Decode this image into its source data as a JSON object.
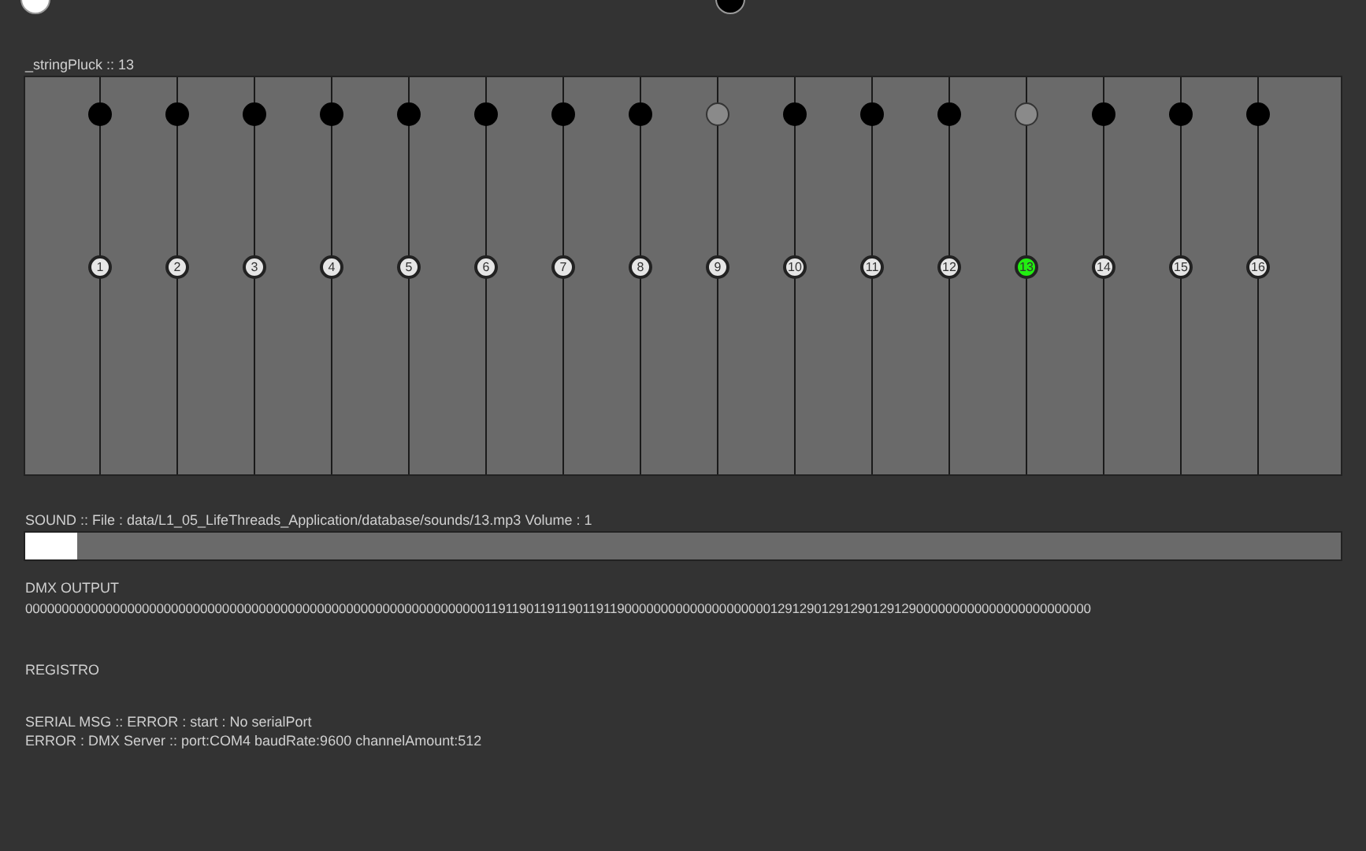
{
  "indicators": [
    {
      "on": true
    },
    {
      "on": false
    }
  ],
  "pluck": {
    "label": "_stringPluck :: 13"
  },
  "strings": [
    {
      "label": "1",
      "active": true,
      "selected": false
    },
    {
      "label": "2",
      "active": true,
      "selected": false
    },
    {
      "label": "3",
      "active": true,
      "selected": false
    },
    {
      "label": "4",
      "active": true,
      "selected": false
    },
    {
      "label": "5",
      "active": true,
      "selected": false
    },
    {
      "label": "6",
      "active": true,
      "selected": false
    },
    {
      "label": "7",
      "active": true,
      "selected": false
    },
    {
      "label": "8",
      "active": true,
      "selected": false
    },
    {
      "label": "9",
      "active": false,
      "selected": false
    },
    {
      "label": "10",
      "active": true,
      "selected": false
    },
    {
      "label": "11",
      "active": true,
      "selected": false
    },
    {
      "label": "12",
      "active": true,
      "selected": false
    },
    {
      "label": "13",
      "active": false,
      "selected": true
    },
    {
      "label": "14",
      "active": true,
      "selected": false
    },
    {
      "label": "15",
      "active": true,
      "selected": false
    },
    {
      "label": "16",
      "active": true,
      "selected": false
    }
  ],
  "sound": {
    "label": "SOUND ::  File : data/L1_05_LifeThreads_Application/database/sounds/13.mp3 Volume : 1",
    "level": 0.04
  },
  "dmx": {
    "title": "DMX OUTPUT",
    "output": "000000000000000000000000000000000000000000000000000000000000000119119011911901191190000000000000000000012912901291290129129000000000000000000000000"
  },
  "log": {
    "title": "REGISTRO",
    "lines": [
      "SERIAL MSG :: ERROR : start : No serialPort",
      "ERROR : DMX Server ::  port:COM4 baudRate:9600 channelAmount:512"
    ]
  }
}
